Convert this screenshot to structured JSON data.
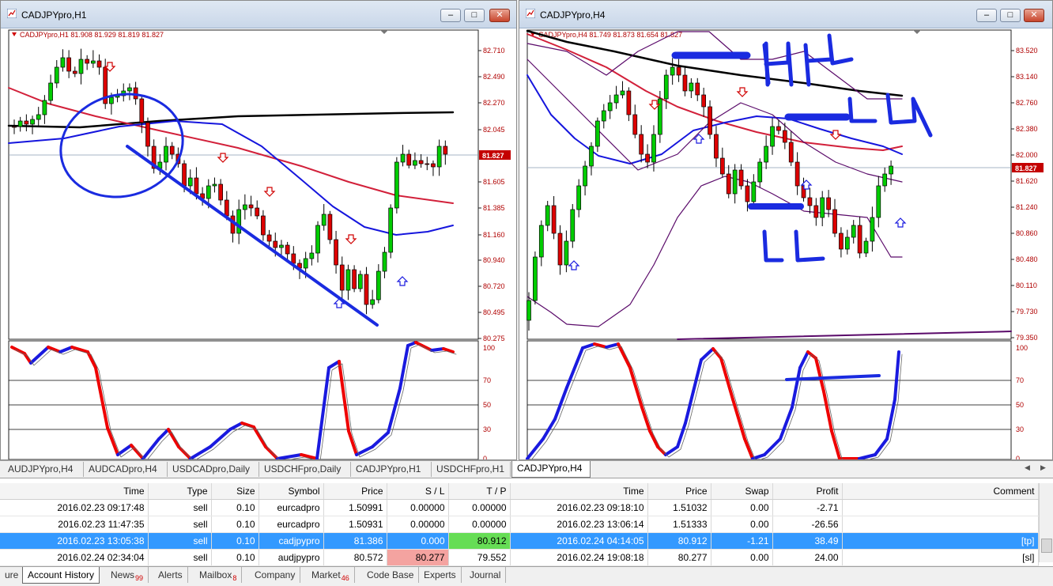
{
  "charts": {
    "h1": {
      "title": "CADJPYpro,H1",
      "info": "CADJPYpro,H1  81.908 81.929 81.819 81.827",
      "price_labels": [
        "82.710",
        "82.490",
        "82.270",
        "82.045",
        "81.605",
        "81.385",
        "81.160",
        "80.940",
        "80.720",
        "80.495",
        "80.275"
      ],
      "current_price": "81.827",
      "osc_labels": [
        "100",
        "70",
        "50",
        "30",
        "0"
      ]
    },
    "h4": {
      "title": "CADJPYpro,H4",
      "info": "CADJPYpro,H4  81.749 81.873 81.654 81.827",
      "price_labels": [
        "83.520",
        "83.140",
        "82.760",
        "82.380",
        "82.000",
        "81.620",
        "81.240",
        "80.860",
        "80.480",
        "80.110",
        "79.730",
        "79.350"
      ],
      "current_price": "81.827",
      "osc_labels": [
        "100",
        "70",
        "50",
        "30",
        "0"
      ]
    },
    "colors": {
      "bull": "#00cc00",
      "bear": "#dd0000",
      "ma_black": "#000000",
      "ma_red": "#d2203a",
      "ma_blue": "#1515dd",
      "bands": "#5a0a6a",
      "drawing": "#1a2be0",
      "price_axis": "#b00000"
    }
  },
  "chart_tabs": [
    "AUDJPYpro,H4",
    "AUDCADpro,H4",
    "USDCADpro,Daily",
    "USDCHFpro,Daily",
    "CADJPYpro,H1",
    "USDCHFpro,H1",
    "CADJPYpro,H4"
  ],
  "active_chart_tab": "CADJPYpro,H4",
  "history": {
    "headers": [
      "Time",
      "Type",
      "Size",
      "Symbol",
      "Price",
      "S / L",
      "T / P",
      "Time",
      "Price",
      "Swap",
      "Profit",
      "Comment"
    ],
    "rows": [
      {
        "open_time": "2016.02.23 09:17:48",
        "type": "sell",
        "size": "0.10",
        "symbol": "eurcadpro",
        "open_price": "1.50991",
        "sl": "0.00000",
        "tp": "0.00000",
        "close_time": "2016.02.23 09:18:10",
        "close_price": "1.51032",
        "swap": "0.00",
        "profit": "-2.71",
        "comment": ""
      },
      {
        "open_time": "2016.02.23 11:47:35",
        "type": "sell",
        "size": "0.10",
        "symbol": "eurcadpro",
        "open_price": "1.50931",
        "sl": "0.00000",
        "tp": "0.00000",
        "close_time": "2016.02.23 13:06:14",
        "close_price": "1.51333",
        "swap": "0.00",
        "profit": "-26.56",
        "comment": ""
      },
      {
        "open_time": "2016.02.23 13:05:38",
        "type": "sell",
        "size": "0.10",
        "symbol": "cadjpypro",
        "open_price": "81.386",
        "sl": "0.000",
        "tp": "80.912",
        "close_time": "2016.02.24 04:14:05",
        "close_price": "80.912",
        "swap": "-1.21",
        "profit": "38.49",
        "comment": "[tp]"
      },
      {
        "open_time": "2016.02.24 02:34:04",
        "type": "sell",
        "size": "0.10",
        "symbol": "audjpypro",
        "open_price": "80.572",
        "sl": "80.277",
        "tp": "79.552",
        "close_time": "2016.02.24 19:08:18",
        "close_price": "80.277",
        "swap": "0.00",
        "profit": "24.00",
        "comment": "[sl]"
      }
    ]
  },
  "bottom_tabs": [
    {
      "label": "ure",
      "badge": ""
    },
    {
      "label": "Account History",
      "badge": ""
    },
    {
      "label": "News",
      "badge": "99"
    },
    {
      "label": "Alerts",
      "badge": ""
    },
    {
      "label": "Mailbox",
      "badge": "8"
    },
    {
      "label": "Company",
      "badge": ""
    },
    {
      "label": "Market",
      "badge": "46"
    },
    {
      "label": "Code Base",
      "badge": ""
    },
    {
      "label": "Experts",
      "badge": ""
    },
    {
      "label": "Journal",
      "badge": ""
    }
  ],
  "active_bottom_tab": "Account History"
}
